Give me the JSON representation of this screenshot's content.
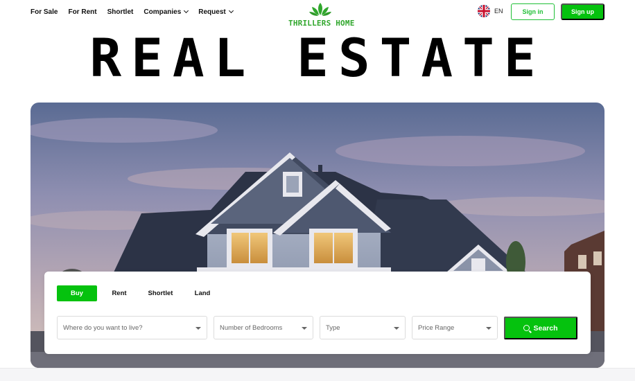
{
  "nav": {
    "items": [
      {
        "label": "For Sale",
        "dropdown": false
      },
      {
        "label": "For Rent",
        "dropdown": false
      },
      {
        "label": "Shortlet",
        "dropdown": false
      },
      {
        "label": "Companies",
        "dropdown": true
      },
      {
        "label": "Request",
        "dropdown": true
      }
    ]
  },
  "brand": {
    "name": "THRILLERS HOME",
    "color": "#31a72d"
  },
  "language": {
    "code": "EN",
    "flag_icon": "uk-flag-icon"
  },
  "auth": {
    "signin_label": "Sign in",
    "signup_label": "Sign up"
  },
  "hero": {
    "title": "REAL ESTATE"
  },
  "search": {
    "tabs": [
      {
        "label": "Buy",
        "active": true
      },
      {
        "label": "Rent",
        "active": false
      },
      {
        "label": "Shortlet",
        "active": false
      },
      {
        "label": "Land",
        "active": false
      }
    ],
    "location_placeholder": "Where do you want to live?",
    "bedrooms_placeholder": "Number of Bedrooms",
    "type_placeholder": "Type",
    "price_placeholder": "Price Range",
    "button_label": "Search"
  },
  "colors": {
    "accent": "#05c20e"
  }
}
